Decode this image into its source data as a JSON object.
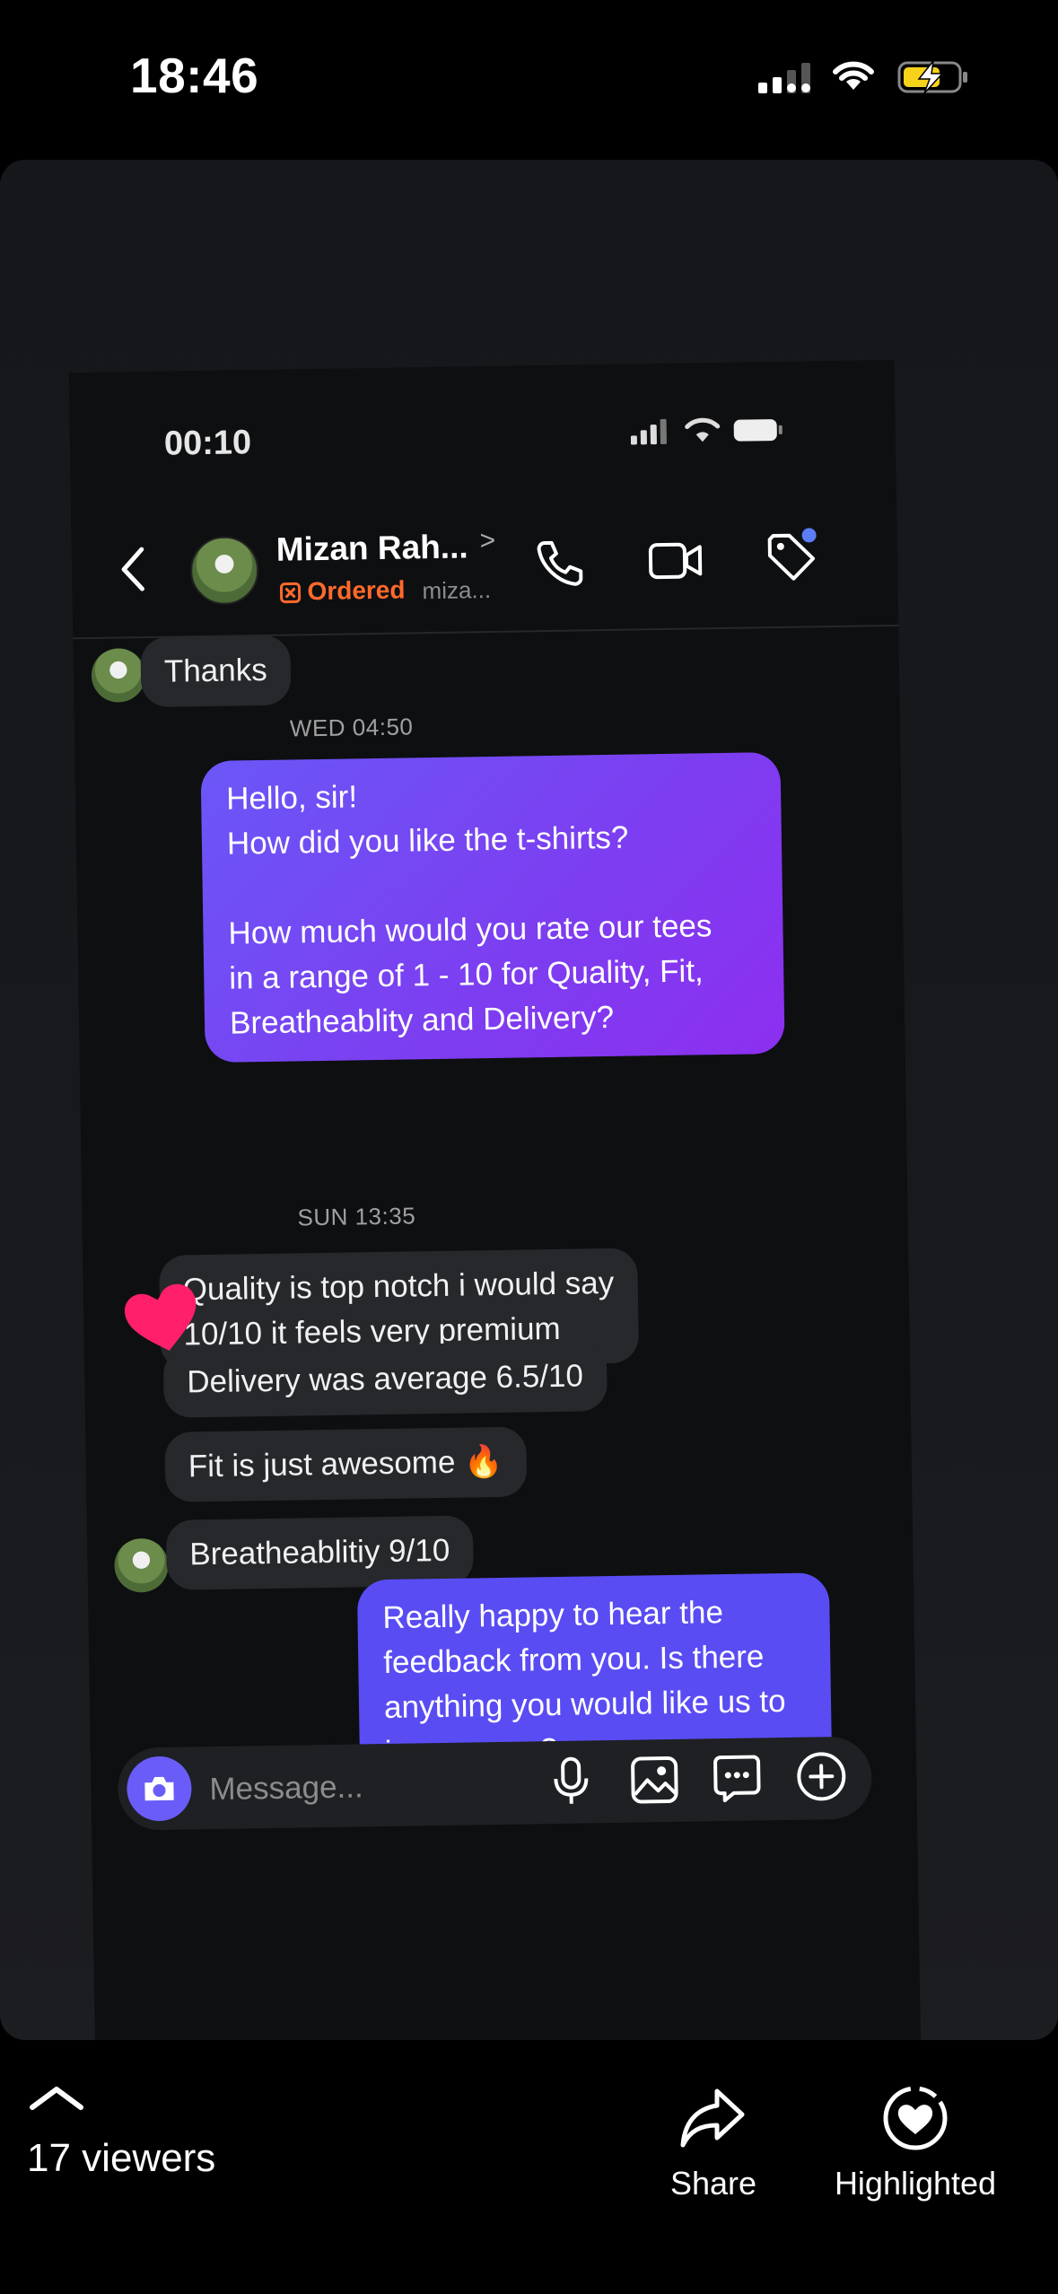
{
  "status_bar": {
    "time": "18:46",
    "battery_charging": true
  },
  "inner_screen": {
    "status_time": "00:10",
    "contact": {
      "name": "Mizan Rah...",
      "chevron": ">",
      "status": "Ordered",
      "handle": "miza..."
    },
    "messages": {
      "thanks": "Thanks",
      "time_1": "WED 04:50",
      "outgoing_1": "Hello, sir!\nHow did you like the t-shirts?\n\nHow much would you rate our tees\nin a range of 1 - 10 for Quality, Fit,\nBreatheablity and Delivery?",
      "time_2": "SUN 13:35",
      "incoming_1": "Quality is top notch i would say\n10/10 it feels very premium",
      "incoming_2": "Delivery was average 6.5/10",
      "incoming_3": "Fit is just awesome 🔥",
      "incoming_4": "Breatheablitiy 9/10",
      "outgoing_2": "Really happy to hear the\nfeedback from you. Is there\nanything you would like us to\nimprove on?"
    },
    "composer": {
      "placeholder": "Message..."
    }
  },
  "bottom_bar": {
    "viewers": "17 viewers",
    "share_label": "Share",
    "highlight_label": "Highlighted"
  },
  "colors": {
    "accent": "#6a5cf8",
    "ordered": "#ff6a2b",
    "outgoing_gradient_start": "#6a57f7",
    "outgoing_gradient_end": "#8d2ff0",
    "heart": "#ff1f6b"
  }
}
